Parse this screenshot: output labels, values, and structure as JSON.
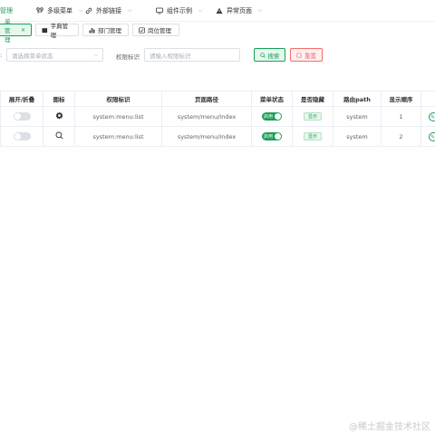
{
  "topnav": {
    "items": [
      {
        "label": "管理",
        "icon": "",
        "active": true
      },
      {
        "label": "多级菜单",
        "icon": "network-icon"
      },
      {
        "label": "外部链接",
        "icon": "link-icon"
      },
      {
        "label": "组件示例",
        "icon": "monitor-icon"
      },
      {
        "label": "异常页面",
        "icon": "warning-icon"
      }
    ]
  },
  "tabs": [
    {
      "label": "单管理",
      "active": true,
      "closable": true
    },
    {
      "label": "字典管理",
      "icon": "book-icon"
    },
    {
      "label": "部门管理",
      "icon": "bar-chart-icon"
    },
    {
      "label": "岗位管理",
      "icon": "checkbox-icon"
    }
  ],
  "search": {
    "status_label": ":",
    "status_placeholder": "请选择菜单状态",
    "perm_label": "权限标识",
    "perm_placeholder": "请输入权限标识",
    "search_label": "搜索",
    "reset_label": "重置"
  },
  "table": {
    "headers": [
      "展开/折叠",
      "图标",
      "权限标识",
      "页面路径",
      "菜单状态",
      "是否隐藏",
      "路由path",
      "显示顺序"
    ],
    "rows": [
      {
        "icon": "gear-icon",
        "perm": "system:menu:list",
        "path": "system/menu/Index",
        "status": "启用",
        "hidden": "显示",
        "route": "system",
        "order": "1"
      },
      {
        "icon": "search-icon",
        "perm": "system:menu:list",
        "path": "system/menu/Index",
        "status": "启用",
        "hidden": "显示",
        "route": "system",
        "order": "2"
      }
    ]
  },
  "watermark": "@稀土掘金技术社区",
  "colors": {
    "accent": "#18a058",
    "danger": "#f56c6c",
    "border": "#ebeef5"
  }
}
